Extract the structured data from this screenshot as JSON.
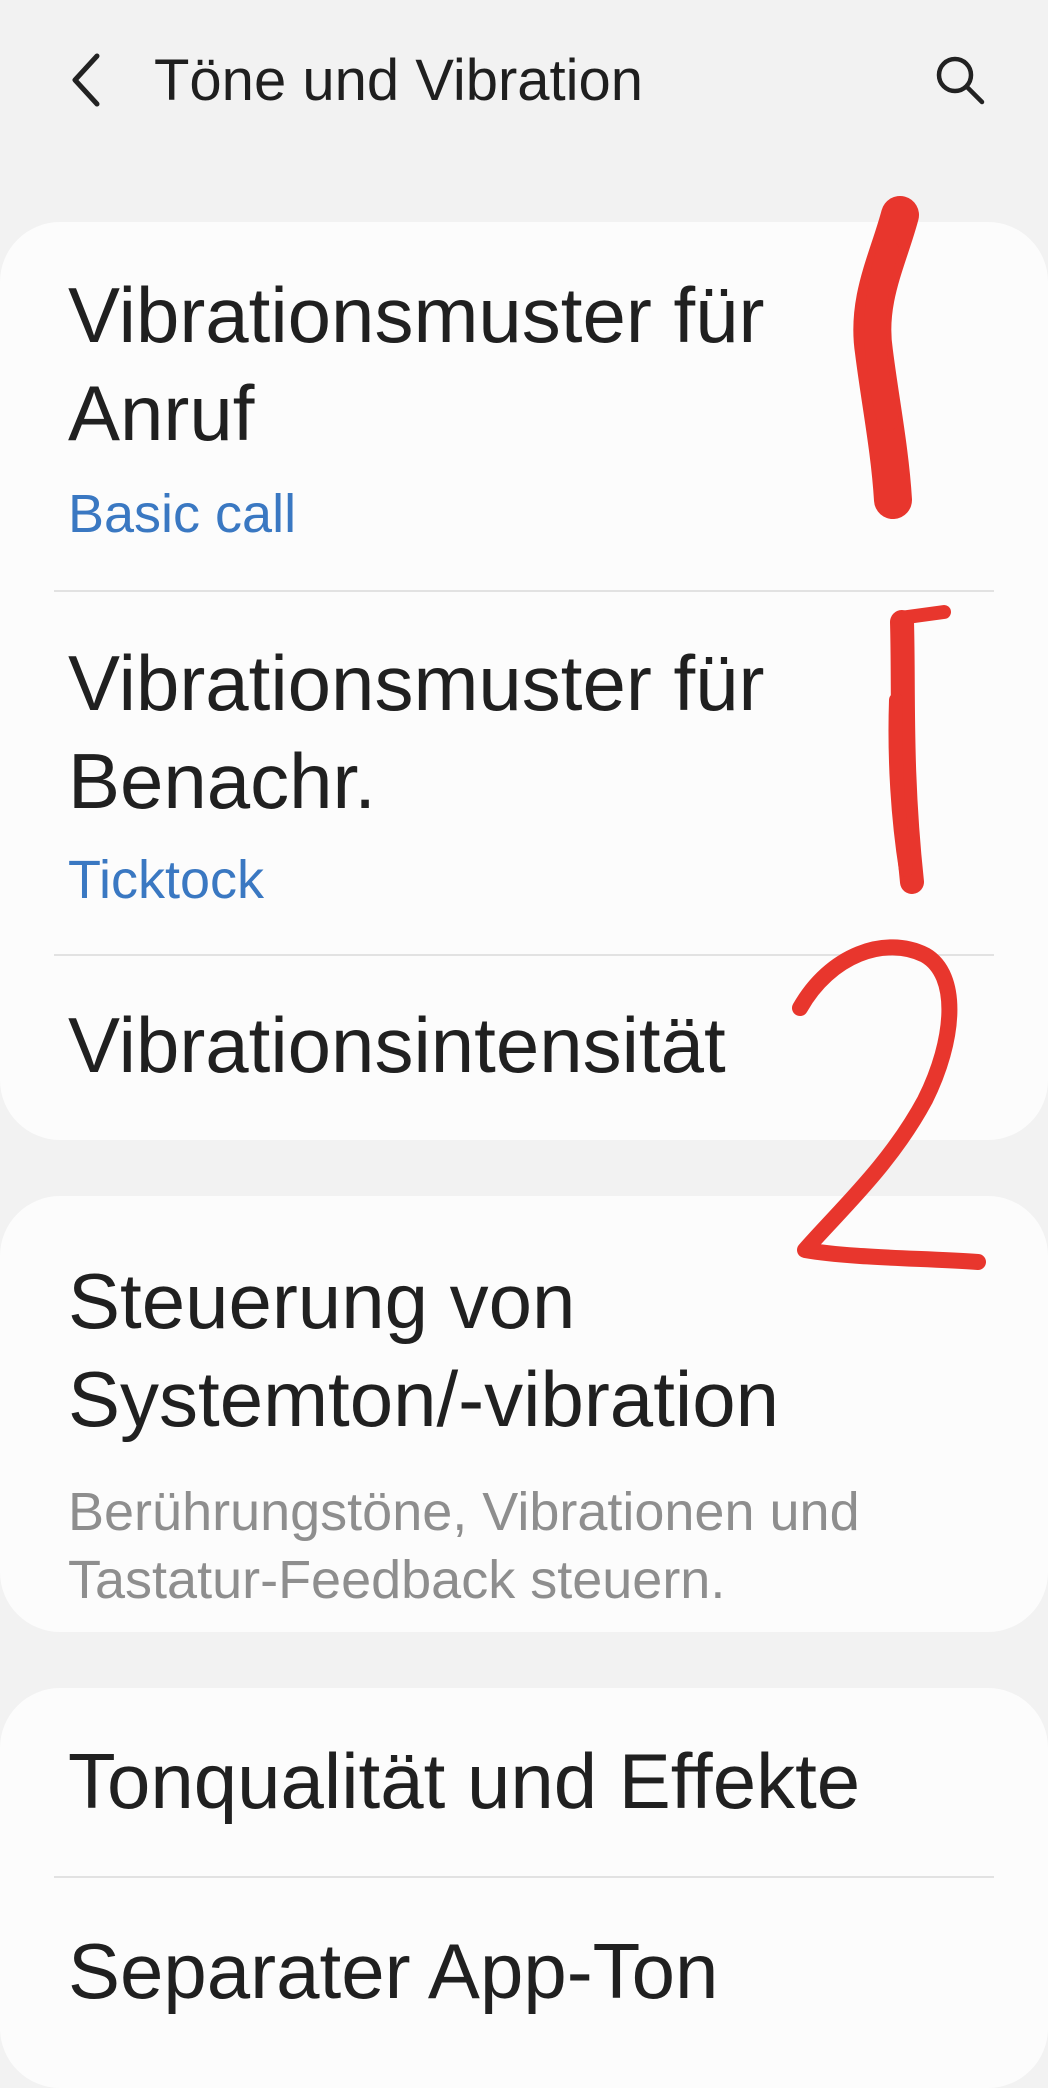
{
  "header": {
    "back_icon": "chevron-left-icon",
    "title": "Töne und Vibration",
    "search_icon": "search-icon"
  },
  "groups": [
    {
      "items": [
        {
          "title": "Vibrationsmuster für Anruf",
          "subtitle": "Basic call"
        },
        {
          "title": "Vibrationsmuster für Benachr.",
          "subtitle": "Ticktock"
        },
        {
          "title": "Vibrationsintensität"
        }
      ]
    },
    {
      "items": [
        {
          "title": "Steuerung von Systemton/-vibration",
          "subtitle": "Berührungstöne, Vibrationen und Tastatur-Feedback steuern."
        }
      ]
    },
    {
      "items": [
        {
          "title": "Tonqualität und Effekte"
        },
        {
          "title": "Separater App-Ton"
        }
      ]
    }
  ],
  "colors": {
    "background": "#f2f2f2",
    "card": "#fcfcfc",
    "accent_blue": "#3a78c2",
    "secondary_text": "#8e8e8e",
    "annotation_red": "#e8362d"
  },
  "annotations": [
    "1",
    "1",
    "2"
  ]
}
